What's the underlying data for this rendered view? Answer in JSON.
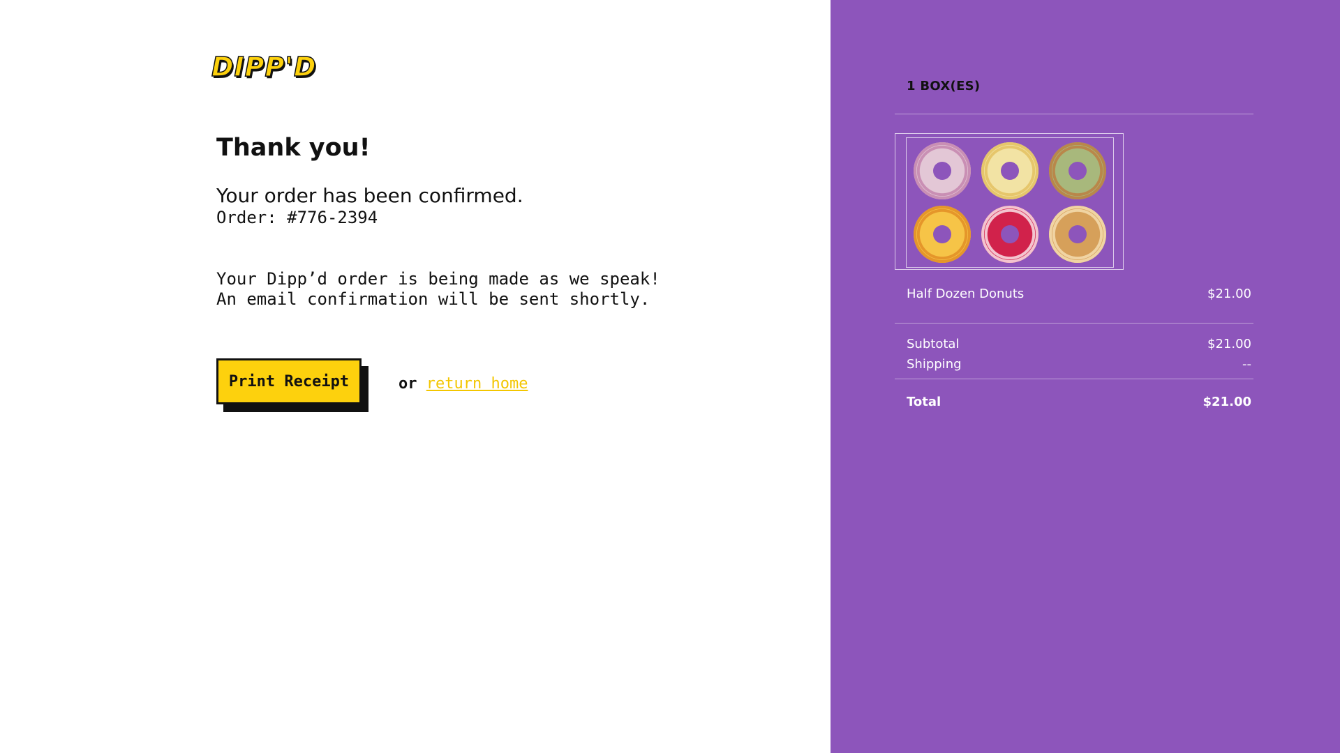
{
  "brand": {
    "logo_text": "DIPP'D"
  },
  "confirmation": {
    "heading": "Thank you!",
    "subheading": "Your order has been confirmed.",
    "order_number": "Order: #776-2394",
    "message_line1": "Your Dipp’d order is being made as we speak!",
    "message_line2": "An email confirmation will be sent shortly.",
    "print_button": "Print Receipt",
    "or_text": "or",
    "return_home_link": "return home"
  },
  "summary": {
    "boxes_label": "1 BOX(ES)",
    "box_image_label": "Half dozen donut box",
    "donuts": [
      {
        "name": "pink-sprinkle-donut",
        "color": "#e3c7d6",
        "accent": "#c98fb4"
      },
      {
        "name": "vanilla-glazed-donut",
        "color": "#f2e3a4",
        "accent": "#e6c66b"
      },
      {
        "name": "matcha-nut-donut",
        "color": "#a8b87c",
        "accent": "#b9874a"
      },
      {
        "name": "orange-glazed-donut",
        "color": "#f6c447",
        "accent": "#e5962a"
      },
      {
        "name": "raspberry-drizzle-donut",
        "color": "#d1224b",
        "accent": "#f3c4cf"
      },
      {
        "name": "crunch-donut",
        "color": "#d6a05a",
        "accent": "#f0d4a3"
      }
    ],
    "item_name": "Half Dozen Donuts",
    "item_price": "$21.00",
    "subtotal_label": "Subtotal",
    "subtotal_value": "$21.00",
    "shipping_label": "Shipping",
    "shipping_value": "--",
    "total_label": "Total",
    "total_value": "$21.00"
  },
  "colors": {
    "brand_yellow": "#fdd10d",
    "panel_purple": "#8d55bb",
    "link_yellow": "#f3c600"
  }
}
